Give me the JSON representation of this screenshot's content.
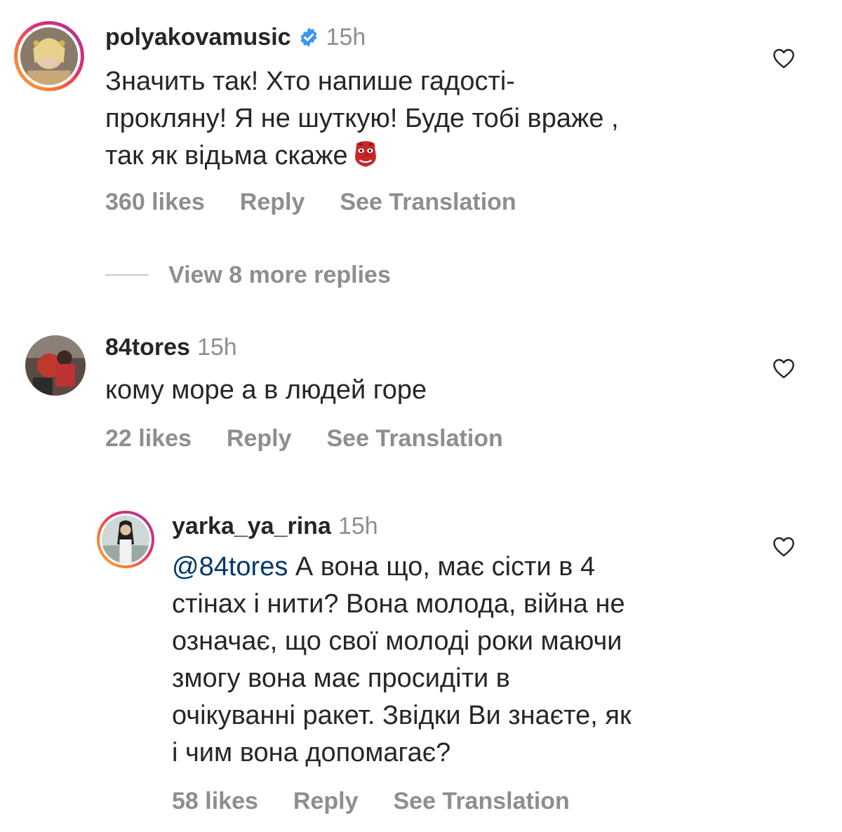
{
  "comments": [
    {
      "username": "polyakovamusic",
      "verified": true,
      "time": "15h",
      "lines": [
        "Значить так! Хто  напише гадості-",
        "прокляну! Я не шуткую! Буде тобі враже ,",
        "так як відьма скаже"
      ],
      "emoji": "red-goblin-mask",
      "likes": "360 likes",
      "reply": "Reply",
      "translate": "See Translation"
    },
    {
      "username": "84tores",
      "time": "15h",
      "lines": [
        "кому море а в людей  горе"
      ],
      "likes": "22 likes",
      "reply": "Reply",
      "translate": "See Translation"
    },
    {
      "username": "yarka_ya_rina",
      "time": "15h",
      "mention": "@84tores",
      "lines": [
        " А вона що, має сісти в 4",
        "стінах і нити? Вона молода, війна не",
        "означає, що свої молоді роки маючи",
        "змогу вона має просидіти в",
        "очікуванні ракет. Звідки Ви знаєте, як",
        "і чим вона допомагає?"
      ],
      "likes": "58 likes",
      "reply": "Reply",
      "translate": "See Translation"
    }
  ],
  "view_replies": "View 8 more replies",
  "colors": {
    "text": "#262626",
    "muted": "#8e8e8e",
    "verified": "#3897f0",
    "mention": "#00376b"
  },
  "icons": [
    "verified-badge-icon",
    "heart-outline-icon",
    "goblin-emoji-icon"
  ]
}
